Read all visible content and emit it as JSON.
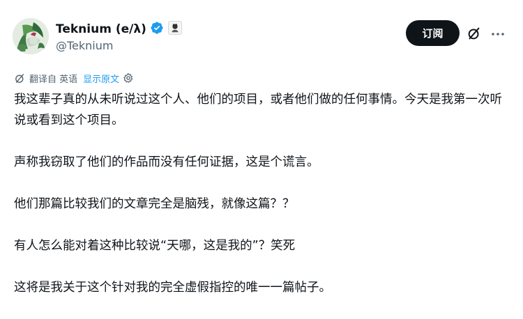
{
  "author": {
    "display_name": "Teknium (e/λ)",
    "handle": "@Teknium",
    "verified": true
  },
  "actions": {
    "subscribe_label": "订阅"
  },
  "translation": {
    "label": "翻译自 英语",
    "show_original": "显示原文"
  },
  "tweet": {
    "paragraphs": [
      "我这辈子真的从未听说过这个人、他们的项目，或者他们做的任何事情。今天是我第一次听说或看到这个项目。",
      "声称我窃取了他们的作品而没有任何证据，这是个谎言。",
      "他们那篇比较我们的文章完全是脑残，就像这篇？？",
      "有人怎么能对着这种比较说“天哪，这是我的”？笑死",
      "这将是我关于这个针对我的完全虚假指控的唯一一篇帖子。"
    ]
  },
  "colors": {
    "text": "#0f1419",
    "secondary": "#536471",
    "accent": "#1d9bf0",
    "button_bg": "#0f1419"
  },
  "icons": [
    "avatar",
    "verified-badge-icon",
    "affiliate-badge-icon",
    "grok-icon",
    "more-icon",
    "translate-icon",
    "gear-icon"
  ]
}
